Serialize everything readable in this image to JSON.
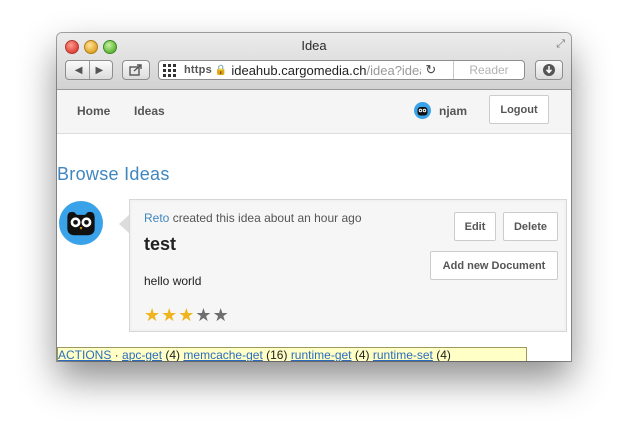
{
  "window": {
    "title": "Idea"
  },
  "toolbar": {
    "scheme": "https",
    "url_domain": "ideahub.cargomedia.ch",
    "url_path": "/idea?idea:",
    "reader_label": "Reader"
  },
  "nav": {
    "home_label": "Home",
    "ideas_label": "Ideas",
    "username": "njam",
    "logout_label": "Logout"
  },
  "page": {
    "heading": "Browse Ideas"
  },
  "idea": {
    "author": "Reto",
    "meta_text": " created this idea about an hour ago",
    "title": "test",
    "body": "hello world",
    "edit_label": "Edit",
    "delete_label": "Delete",
    "add_document_label": "Add new Document",
    "rating": 3,
    "rating_max": 5
  },
  "debug_bar": {
    "prefix": "ACTIONS",
    "separator": " · ",
    "items": [
      {
        "name": "apc-get",
        "count": "(4)"
      },
      {
        "name": "memcache-get",
        "count": "(16)"
      },
      {
        "name": "runtime-get",
        "count": "(4)"
      },
      {
        "name": "runtime-set",
        "count": "(4)"
      }
    ]
  },
  "colors": {
    "accent": "#3f86bf",
    "avatar_bg": "#3aa2e8",
    "star_on": "#f0b41e",
    "star_off": "#6f6f6f",
    "debug_bg": "#ffffc6"
  }
}
